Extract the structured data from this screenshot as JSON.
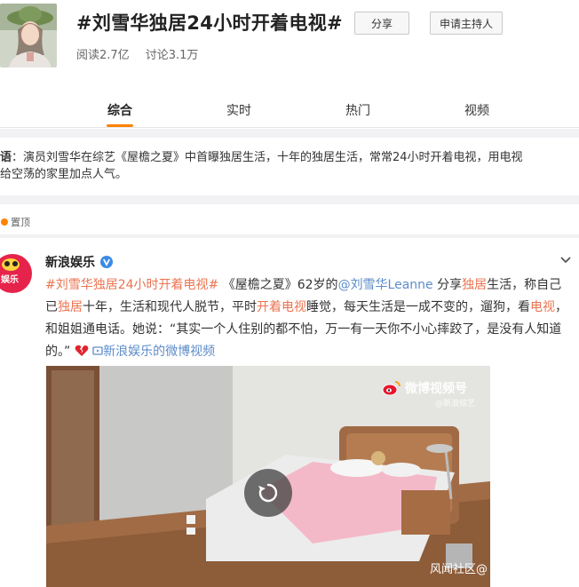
{
  "header": {
    "title": "#刘雪华独居24小时开着电视#",
    "share_label": "分享",
    "host_label": "申请主持人",
    "reads": "阅读2.7亿",
    "discussions": "讨论3.1万"
  },
  "tabs": [
    {
      "label": "综合",
      "active": true
    },
    {
      "label": "实时",
      "active": false
    },
    {
      "label": "热门",
      "active": false
    },
    {
      "label": "视频",
      "active": false
    }
  ],
  "guide": {
    "label": "导语",
    "text_line1": "：演员刘雪华在综艺《屋檐之夏》中首曝独居生活，十年的独居生活，常常24小时开着电视，用电视",
    "text_line2": "声给空荡的家里加点人气。"
  },
  "pinned_label": "置顶",
  "post": {
    "author": "新浪娱乐",
    "text": {
      "hashtag": "#刘雪华独居24小时开着电视#",
      "t1": "《屋檐之夏》62岁的",
      "mention": "@刘雪华Leanne",
      "t2": " 分享",
      "k1": "独居",
      "t3": "生活，称自己已",
      "k2": "独居",
      "t4": "十年，生活和现代人脱节，平时",
      "k3": "开着电视",
      "t5": "睡觉，每天生活是一成不变的，遛狗，看",
      "k4": "电视",
      "t6": "，和姐姐通电话。她说：“其实一个人住别的都不怕，万一有一天你不小心摔跤了，是没有人知道的。”",
      "video_link": "新浪娱乐的微博视频"
    }
  },
  "video": {
    "watermark": "微博视频号",
    "watermark_sub": "@新浪综艺"
  },
  "footer_watermark": "风闻社区@",
  "colors": {
    "accent": "#ff8200",
    "highlight": "#eb7350",
    "link": "#5d8cc9"
  }
}
